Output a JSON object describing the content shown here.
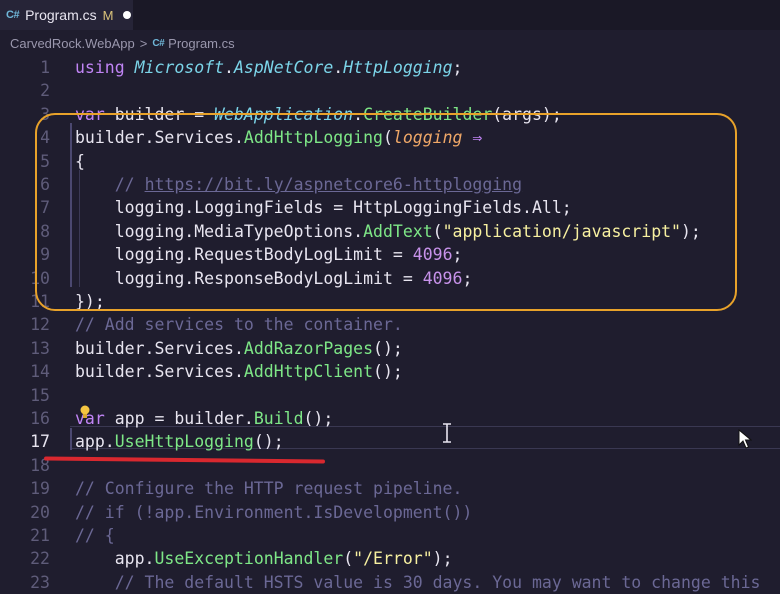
{
  "tab": {
    "icon": "C#",
    "name": "Program.cs",
    "modified": "M"
  },
  "breadcrumb": {
    "project": "CarvedRock.WebApp",
    "separator": ">",
    "icon": "C#",
    "file": "Program.cs"
  },
  "editor": {
    "current_line": 17,
    "lines": [
      {
        "n": "1",
        "tokens": [
          [
            "kw",
            "using "
          ],
          [
            "typ",
            "Microsoft"
          ],
          [
            "txt",
            "."
          ],
          [
            "typ",
            "AspNetCore"
          ],
          [
            "txt",
            "."
          ],
          [
            "typ",
            "HttpLogging"
          ],
          [
            "txt",
            ";"
          ]
        ]
      },
      {
        "n": "2",
        "tokens": []
      },
      {
        "n": "3",
        "tokens": [
          [
            "kw",
            "var "
          ],
          [
            "txt",
            "builder = "
          ],
          [
            "typ",
            "WebApplication"
          ],
          [
            "txt",
            "."
          ],
          [
            "fn",
            "CreateBuilder"
          ],
          [
            "txt",
            "(args);"
          ]
        ]
      },
      {
        "n": "4",
        "tokens": [
          [
            "txt",
            "builder.Services."
          ],
          [
            "fn",
            "AddHttpLogging"
          ],
          [
            "txt",
            "("
          ],
          [
            "param",
            "logging"
          ],
          [
            "kw",
            " ⇒"
          ]
        ]
      },
      {
        "n": "5",
        "tokens": [
          [
            "txt",
            "{"
          ]
        ]
      },
      {
        "n": "6",
        "tokens": [
          [
            "txt",
            "    "
          ],
          [
            "cm",
            "// "
          ],
          [
            "link",
            "https://bit.ly/aspnetcore6-httplogging"
          ]
        ]
      },
      {
        "n": "7",
        "tokens": [
          [
            "txt",
            "    logging.LoggingFields = HttpLoggingFields.All;"
          ]
        ]
      },
      {
        "n": "8",
        "tokens": [
          [
            "txt",
            "    logging.MediaTypeOptions."
          ],
          [
            "fn",
            "AddText"
          ],
          [
            "txt",
            "("
          ],
          [
            "str",
            "\"application/javascript\""
          ],
          [
            "txt",
            ");"
          ]
        ]
      },
      {
        "n": "9",
        "tokens": [
          [
            "txt",
            "    logging.RequestBodyLogLimit = "
          ],
          [
            "num",
            "4096"
          ],
          [
            "txt",
            ";"
          ]
        ]
      },
      {
        "n": "10",
        "tokens": [
          [
            "txt",
            "    logging.ResponseBodyLogLimit = "
          ],
          [
            "num",
            "4096"
          ],
          [
            "txt",
            ";"
          ]
        ]
      },
      {
        "n": "11",
        "tokens": [
          [
            "txt",
            "});"
          ]
        ]
      },
      {
        "n": "12",
        "tokens": [
          [
            "cm",
            "// Add services to the container."
          ]
        ]
      },
      {
        "n": "13",
        "tokens": [
          [
            "txt",
            "builder.Services."
          ],
          [
            "fn",
            "AddRazorPages"
          ],
          [
            "txt",
            "();"
          ]
        ]
      },
      {
        "n": "14",
        "tokens": [
          [
            "txt",
            "builder.Services."
          ],
          [
            "fn",
            "AddHttpClient"
          ],
          [
            "txt",
            "();"
          ]
        ]
      },
      {
        "n": "15",
        "tokens": []
      },
      {
        "n": "16",
        "tokens": [
          [
            "kw",
            "var "
          ],
          [
            "txt",
            "app = builder."
          ],
          [
            "fn",
            "Build"
          ],
          [
            "txt",
            "();"
          ]
        ]
      },
      {
        "n": "17",
        "tokens": [
          [
            "txt",
            "app."
          ],
          [
            "fn",
            "UseHttpLogging"
          ],
          [
            "txt",
            "();"
          ]
        ]
      },
      {
        "n": "18",
        "tokens": []
      },
      {
        "n": "19",
        "tokens": [
          [
            "cm",
            "// Configure the HTTP request pipeline."
          ]
        ]
      },
      {
        "n": "20",
        "tokens": [
          [
            "cm",
            "// if (!app.Environment.IsDevelopment())"
          ]
        ]
      },
      {
        "n": "21",
        "tokens": [
          [
            "cm",
            "// {"
          ]
        ]
      },
      {
        "n": "22",
        "tokens": [
          [
            "txt",
            "    app."
          ],
          [
            "fn",
            "UseExceptionHandler"
          ],
          [
            "txt",
            "("
          ],
          [
            "str",
            "\"/Error\""
          ],
          [
            "txt",
            ");"
          ]
        ]
      },
      {
        "n": "23",
        "tokens": [
          [
            "cm",
            "    // The default HSTS value is 30 days. You may want to change this"
          ]
        ]
      }
    ]
  },
  "colors": {
    "background": "#1f1d2e",
    "highlight_box": "#e8a22a",
    "underline": "#d9282f",
    "keyword": "#c084f5",
    "method": "#7ee787",
    "type": "#7bd4e8",
    "string": "#f7f0a0",
    "comment": "#6b6895"
  }
}
